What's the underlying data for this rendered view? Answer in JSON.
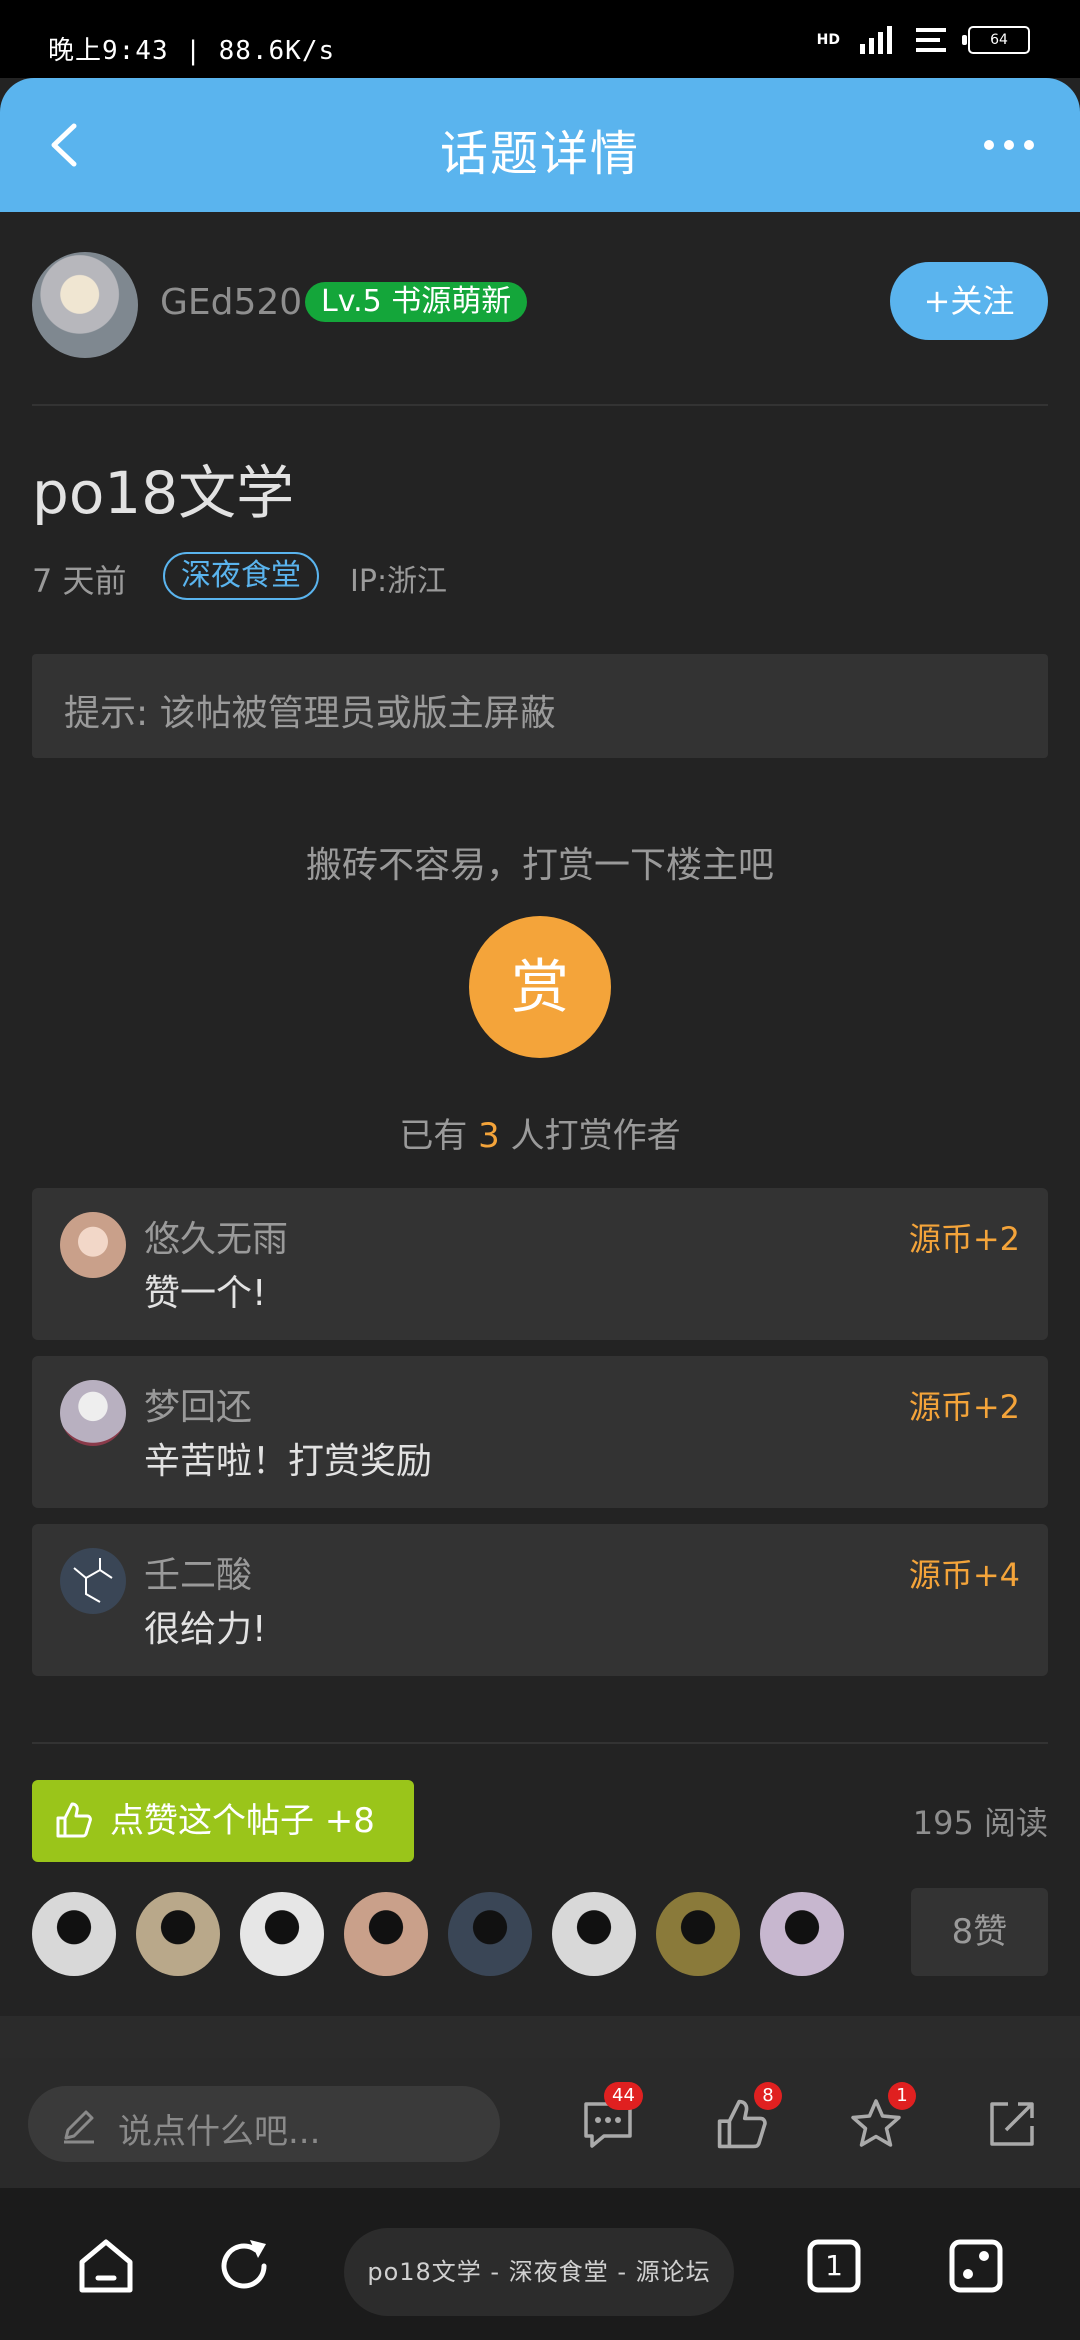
{
  "status_bar": {
    "time": "晚上9:43 | 88.6K/s",
    "hd_label": "HD",
    "battery": "64"
  },
  "header": {
    "title": "话题详情"
  },
  "author": {
    "name": "GEd520",
    "level_badge": "Lv.5 书源萌新",
    "follow_label": "+关注"
  },
  "post": {
    "title": "po18文学",
    "time": "7 天前",
    "tag": "深夜食堂",
    "ip": "IP:浙江",
    "notice": "提示: 该帖被管理员或版主屏蔽"
  },
  "reward": {
    "prompt": "搬砖不容易，打赏一下楼主吧",
    "button_label": "赏",
    "count_prefix": "已有",
    "count": "3",
    "count_suffix": "人打赏作者"
  },
  "tips": [
    {
      "name": "悠久无雨",
      "message": "赞一个!",
      "coins": "源币+2",
      "avatar_color": "#c9a08a"
    },
    {
      "name": "梦回还",
      "message": "辛苦啦！打赏奖励",
      "coins": "源币+2",
      "avatar_color": "#b8b0c0"
    },
    {
      "name": "壬二酸",
      "message": "很给力!",
      "coins": "源币+4",
      "avatar_color": "#3a4656"
    }
  ],
  "actions": {
    "like_label": "点赞这个帖子 +8",
    "reads": "195 阅读",
    "likes_count": "8赞",
    "liker_colors": [
      "#d8d8d8",
      "#b9a88a",
      "#e6e6e6",
      "#c9a08a",
      "#3a4656",
      "#d8d8d8",
      "#8a7a3a",
      "#c7b7cf"
    ]
  },
  "bottom_bar": {
    "comment_placeholder": "说点什么吧...",
    "comment_badge": "44",
    "like_badge": "8",
    "star_badge": "1"
  },
  "nav": {
    "page_label": "po18文学 - 深夜食堂 - 源论坛",
    "tab_count": "1"
  },
  "colors": {
    "accent": "#5ab4ee",
    "reward": "#f4a43a",
    "like_green": "#9ac51a",
    "level_green": "#14a63a",
    "badge_red": "#e02020"
  }
}
